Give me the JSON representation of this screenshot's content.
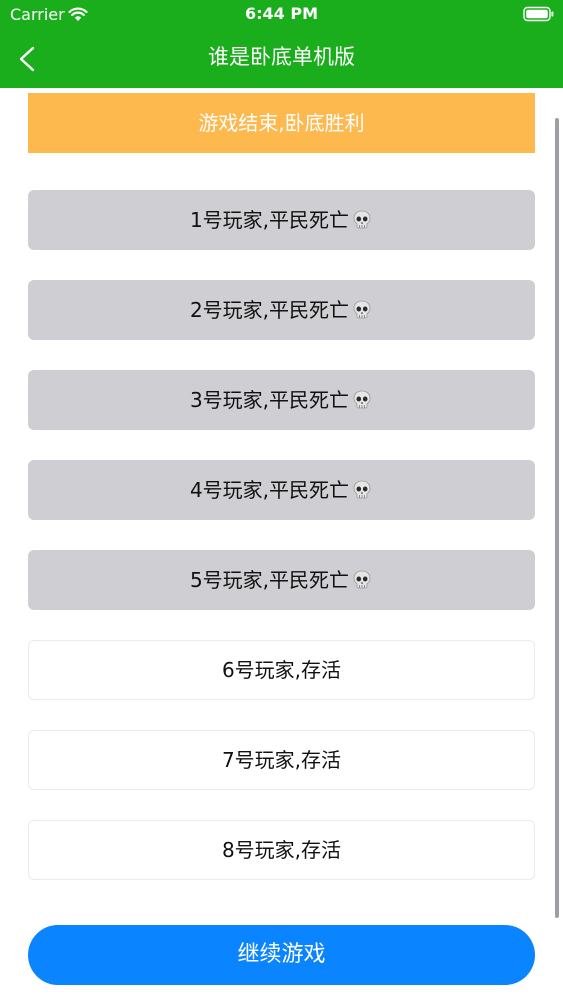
{
  "status_bar": {
    "carrier": "Carrier",
    "time": "6:44 PM",
    "wifi_icon": "wifi-icon",
    "battery_icon": "battery-icon"
  },
  "nav": {
    "back_icon": "chevron-left-icon",
    "title": "谁是卧底单机版"
  },
  "result_banner": {
    "text": "游戏结束,卧底胜利"
  },
  "players": [
    {
      "label": "1号玩家,平民死亡",
      "status": "dead",
      "icon": "skull-icon"
    },
    {
      "label": "2号玩家,平民死亡",
      "status": "dead",
      "icon": "skull-icon"
    },
    {
      "label": "3号玩家,平民死亡",
      "status": "dead",
      "icon": "skull-icon"
    },
    {
      "label": "4号玩家,平民死亡",
      "status": "dead",
      "icon": "skull-icon"
    },
    {
      "label": "5号玩家,平民死亡",
      "status": "dead",
      "icon": "skull-icon"
    },
    {
      "label": "6号玩家,存活",
      "status": "alive"
    },
    {
      "label": "7号玩家,存活",
      "status": "alive"
    },
    {
      "label": "8号玩家,存活",
      "status": "alive"
    }
  ],
  "continue_button": {
    "label": "继续游戏"
  },
  "colors": {
    "nav_green": "#1AAE1C",
    "banner_orange": "#FDB84E",
    "dead_gray": "#CFCFD3",
    "button_blue": "#0A84FF"
  }
}
